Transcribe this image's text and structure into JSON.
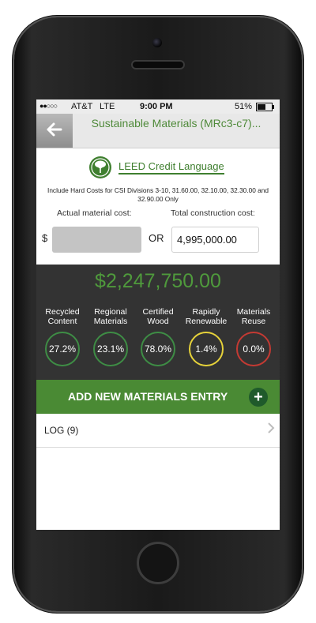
{
  "status": {
    "carrier": "AT&T",
    "network": "LTE",
    "time": "9:00 PM",
    "battery": "51%"
  },
  "nav": {
    "back_icon": "back-arrow-icon",
    "title": "Sustainable Materials (MRc3-c7)..."
  },
  "leed": {
    "link_label": "LEED Credit Language",
    "logo_icon": "leed-tree-logo"
  },
  "note": "Include Hard Costs for CSI Divisions 3-10, 31.60.00, 32.10.00, 32.30.00 and 32.90.00 Only",
  "costs": {
    "actual_label": "Actual material cost:",
    "total_label": "Total construction cost:",
    "currency_symbol": "$",
    "actual_value": "",
    "or_label": "OR",
    "total_value": "4,995,000.00"
  },
  "summary": {
    "amount": "$2,247,750.00"
  },
  "metrics": [
    {
      "label": "Recycled Content",
      "value": "27.2%",
      "color": "#3e8d45"
    },
    {
      "label": "Regional Materials",
      "value": "23.1%",
      "color": "#3e8d45"
    },
    {
      "label": "Certified Wood",
      "value": "78.0%",
      "color": "#3e8d45"
    },
    {
      "label": "Rapidly Renewable",
      "value": "1.4%",
      "color": "#e6d23a"
    },
    {
      "label": "Materials Reuse",
      "value": "0.0%",
      "color": "#c43a33"
    }
  ],
  "add_entry": {
    "label": "ADD NEW MATERIALS ENTRY",
    "plus_icon": "plus-circle-icon"
  },
  "log": {
    "label": "LOG (9)",
    "chevron_icon": "chevron-right-icon"
  },
  "colors": {
    "accent_green": "#4a8a34",
    "dark_panel": "#333333"
  }
}
